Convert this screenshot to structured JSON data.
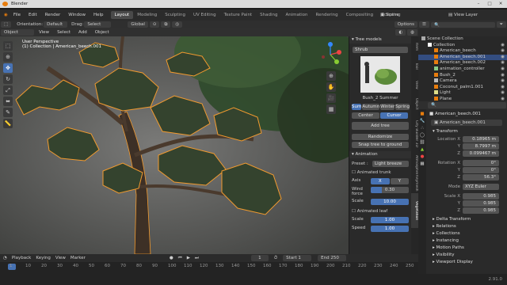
{
  "app": {
    "title": "Blender",
    "version": "2.91.0"
  },
  "menus": [
    "File",
    "Edit",
    "Render",
    "Window",
    "Help"
  ],
  "workspaces": [
    {
      "label": "Layout",
      "active": true
    },
    {
      "label": "Modeling"
    },
    {
      "label": "Sculpting"
    },
    {
      "label": "UV Editing"
    },
    {
      "label": "Texture Paint"
    },
    {
      "label": "Shading"
    },
    {
      "label": "Animation"
    },
    {
      "label": "Rendering"
    },
    {
      "label": "Compositing"
    },
    {
      "label": "Scripting"
    }
  ],
  "scene": {
    "label": "Scene",
    "view_layer": "View Layer"
  },
  "tool_header": {
    "orientation_label": "Orientation:",
    "orientation_value": "Default",
    "drag_label": "Drag:",
    "drag_value": "Select Box",
    "transform": "Global",
    "options": "Options"
  },
  "view_header": {
    "mode": "Object Mode",
    "items": [
      "View",
      "Select",
      "Add",
      "Object"
    ]
  },
  "viewport": {
    "perspective": "User Perspective",
    "collection_line": "(1) Collection | American_beech.001"
  },
  "gizmo": {
    "x": "X",
    "y": "Y",
    "z": "Z"
  },
  "npanel": {
    "title": "Tree models",
    "category": "Shrub",
    "model_name": "Bush_2 Summer",
    "seasons": [
      {
        "label": "Sum",
        "active": true
      },
      {
        "label": "Autumn"
      },
      {
        "label": "Winter"
      },
      {
        "label": "Spring"
      }
    ],
    "pivot": [
      {
        "label": "Center"
      },
      {
        "label": "Cursor",
        "active": true
      }
    ],
    "add_tree": "Add tree",
    "randomize": "Randomize",
    "snap": "Snap tree to ground",
    "animation_title": "Animation",
    "preset_label": "Preset :",
    "preset_value": "Light breeze",
    "animated_trunk": "Animated trunk",
    "axis_label": "Axis",
    "axis_x": "X",
    "axis_y": "Y",
    "wind_force_label": "Wind force",
    "wind_force": "0.30",
    "wind_force_frac": 0.3,
    "scale1_label": "Scale",
    "scale1": "10.00",
    "animated_leaf": "Animated leaf",
    "scale2_label": "Scale",
    "scale2": "1.00",
    "speed_label": "Speed",
    "speed": "1.00",
    "tabs": [
      "Item",
      "Tool",
      "View",
      "Object",
      "City Builder 3D",
      "Atmosphere",
      "Keymesh",
      "Vegetation"
    ]
  },
  "outliner": {
    "rows": [
      {
        "label": "Scene Collection",
        "indent": 0
      },
      {
        "label": "Collection",
        "indent": 1
      },
      {
        "label": "American_beech",
        "indent": 2
      },
      {
        "label": "American_beech.001",
        "indent": 2,
        "selected": true
      },
      {
        "label": "American_beech.002",
        "indent": 2
      },
      {
        "label": "animation_controller",
        "indent": 2
      },
      {
        "label": "Bush_2",
        "indent": 2
      },
      {
        "label": "Camera",
        "indent": 2
      },
      {
        "label": "Coconut_palm1.001",
        "indent": 2
      },
      {
        "label": "Light",
        "indent": 2
      },
      {
        "label": "Plane",
        "indent": 2
      }
    ]
  },
  "properties": {
    "object_name": "American_beech.001",
    "mesh_name": "American_beech.001",
    "transform": "Transform",
    "location_label": "Location X",
    "loc_x": "0.18965 m",
    "loc_y": "8.7997 m",
    "loc_z": "0.099467 m",
    "rotation_label": "Rotation X",
    "rot_x": "0°",
    "rot_y": "0°",
    "rot_z": "56.3°",
    "mode_label": "Mode",
    "mode_value": "XYZ Euler",
    "scale_label": "Scale X",
    "sc_x": "0.985",
    "sc_y": "0.985",
    "sc_z": "0.985",
    "y": "Y",
    "z": "Z",
    "sections": [
      "Delta Transform",
      "Relations",
      "Collections",
      "Instancing",
      "Motion Paths",
      "Visibility",
      "Viewport Display"
    ]
  },
  "timeline": {
    "playback": "Playback",
    "keying": "Keying",
    "view": "View",
    "marker": "Marker",
    "current": "1",
    "start_label": "Start",
    "start": "1",
    "end_label": "End",
    "end": "250",
    "ticks": [
      "1",
      "10",
      "20",
      "30",
      "40",
      "50",
      "60",
      "70",
      "80",
      "90",
      "100",
      "110",
      "120",
      "130",
      "140",
      "150",
      "160",
      "170",
      "180",
      "190",
      "200",
      "210",
      "220",
      "230",
      "240",
      "250"
    ]
  }
}
